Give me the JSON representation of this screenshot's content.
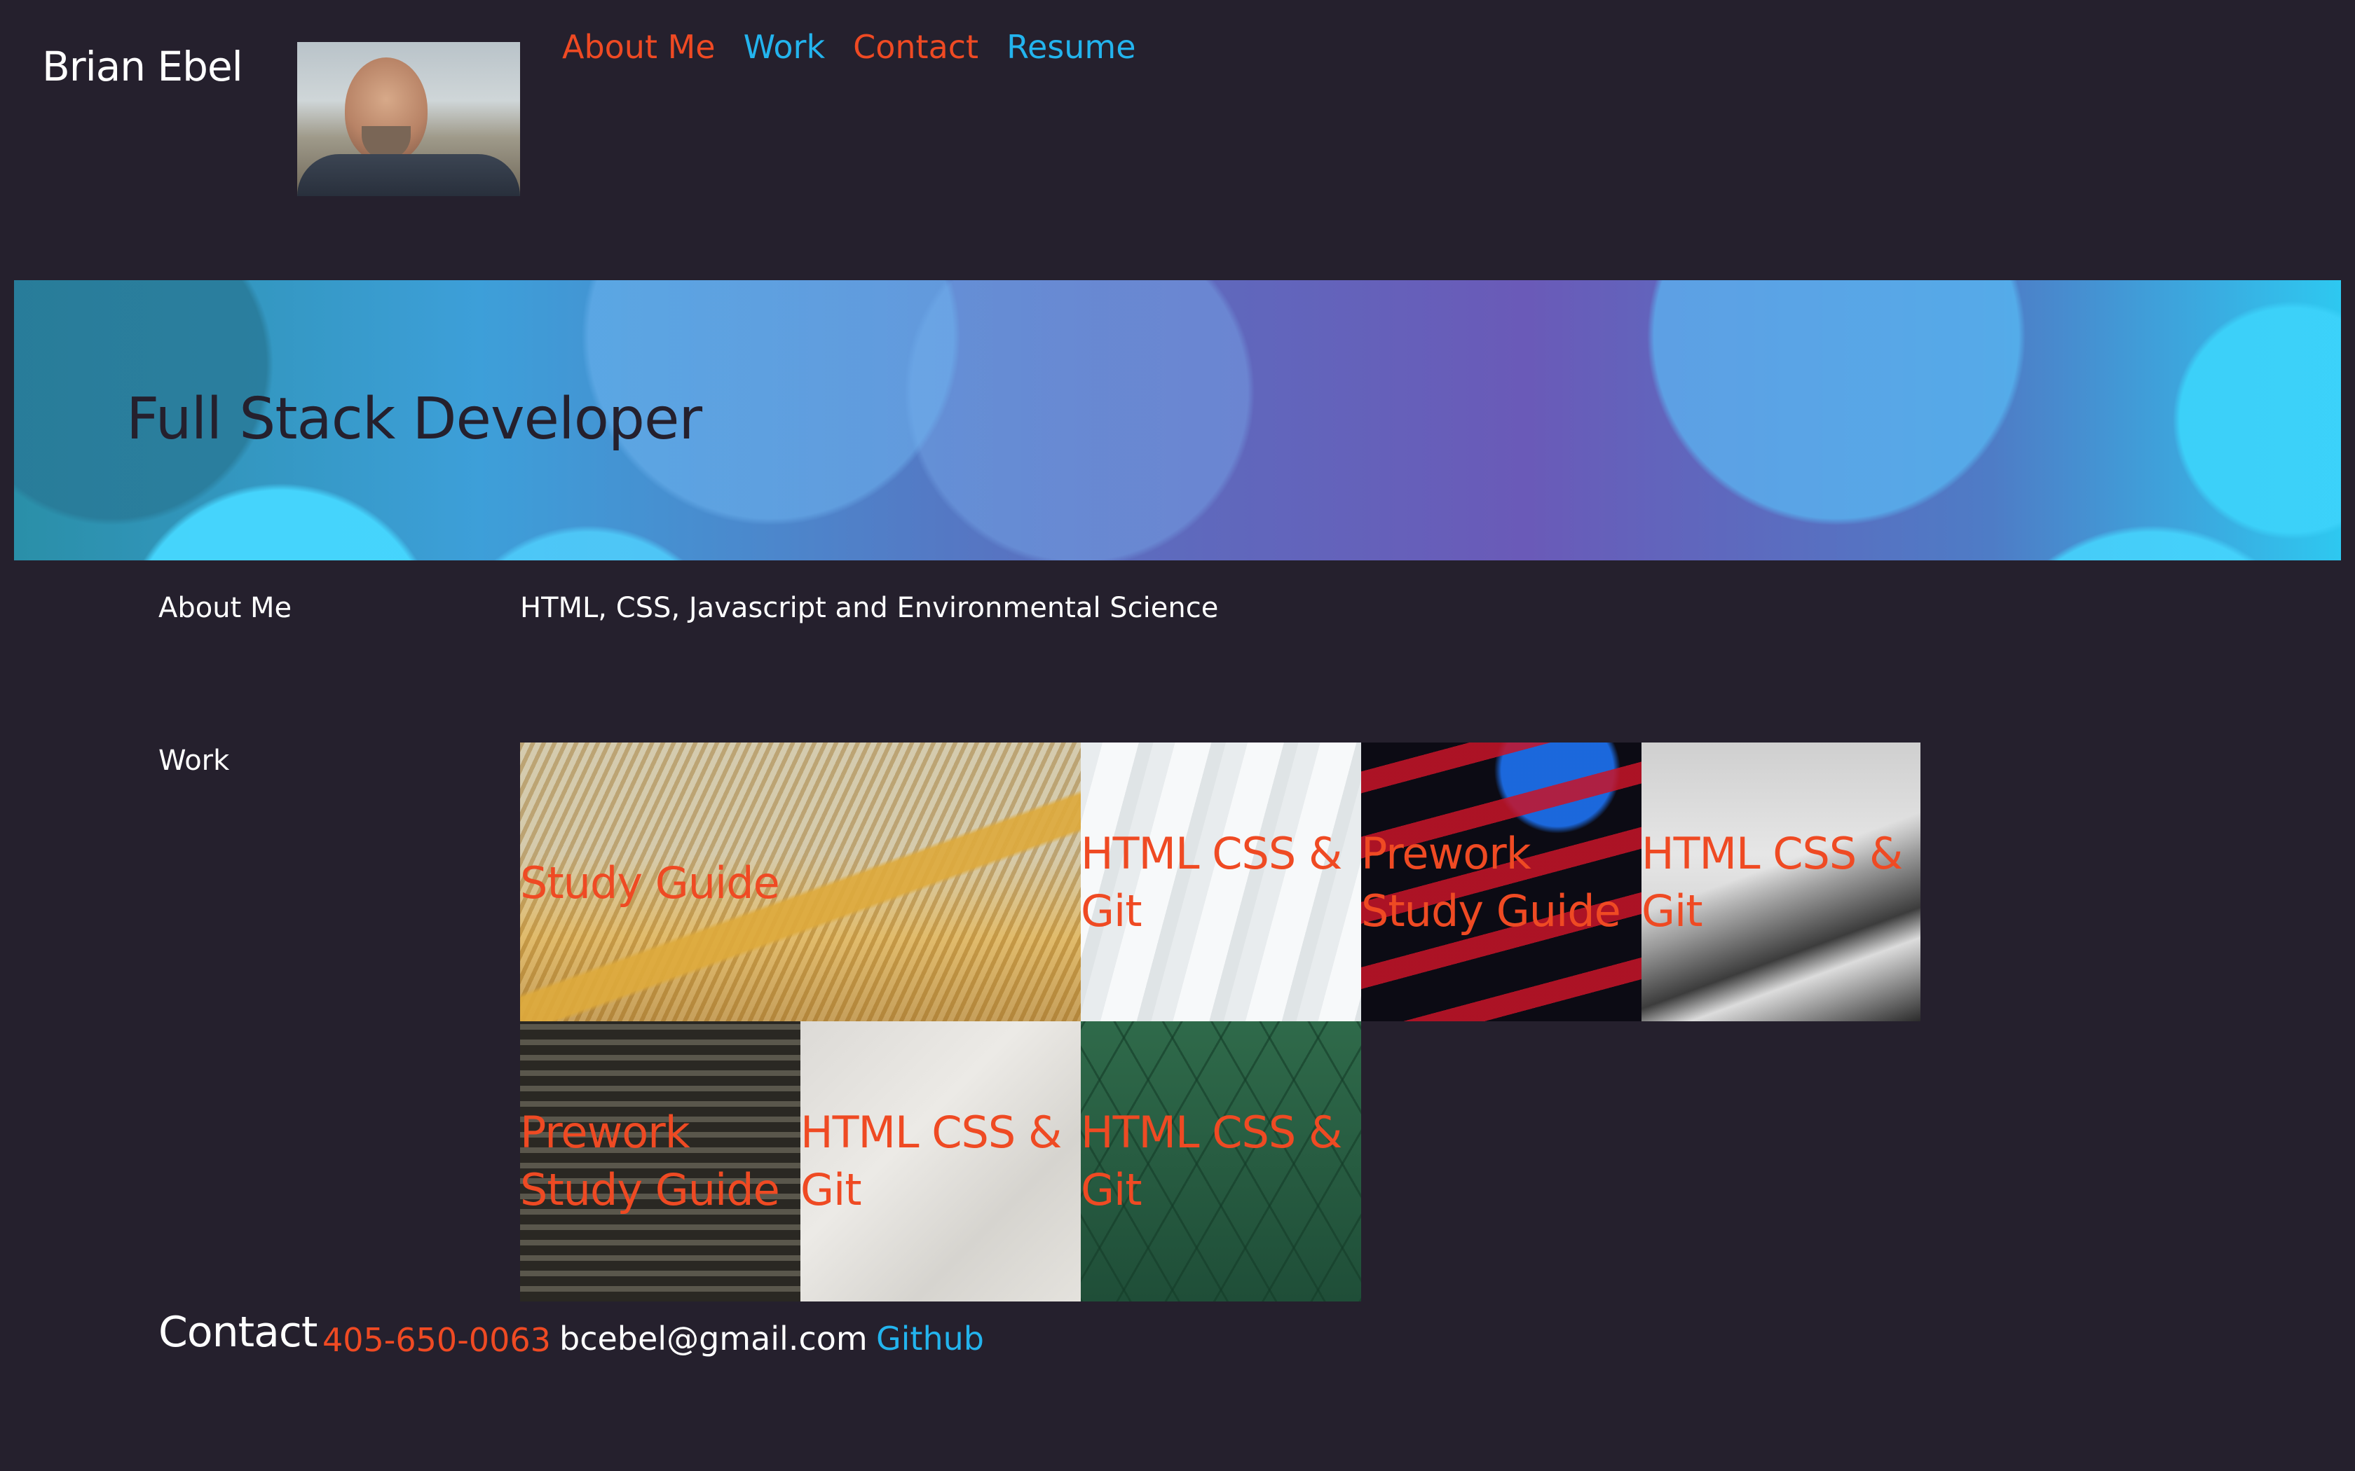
{
  "header": {
    "name": "Brian Ebel",
    "nav": [
      {
        "label": "About Me",
        "color": "#ef4a23"
      },
      {
        "label": "Work",
        "color": "#23b4ee"
      },
      {
        "label": "Contact",
        "color": "#ef4a23"
      },
      {
        "label": "Resume",
        "color": "#23b4ee"
      }
    ]
  },
  "hero": {
    "title": "Full Stack Developer"
  },
  "about": {
    "label": "About Me",
    "text": "HTML, CSS, Javascript and Environmental Science"
  },
  "work": {
    "label": "Work",
    "projects": [
      {
        "title": "Study Guide"
      },
      {
        "title": "HTML CSS & Git"
      },
      {
        "title": "Prework Study Guide"
      },
      {
        "title": "HTML CSS & Git"
      },
      {
        "title": "Prework Study Guide"
      },
      {
        "title": "HTML CSS & Git"
      },
      {
        "title": "HTML CSS & Git"
      }
    ]
  },
  "contact": {
    "title": "Contact",
    "phone": "405-650-0063",
    "email": "bcebel@gmail.com",
    "github": "Github"
  },
  "colors": {
    "background": "#25202d",
    "accent_orange": "#ef4a23",
    "accent_blue": "#23b4ee",
    "text": "#ffffff"
  }
}
